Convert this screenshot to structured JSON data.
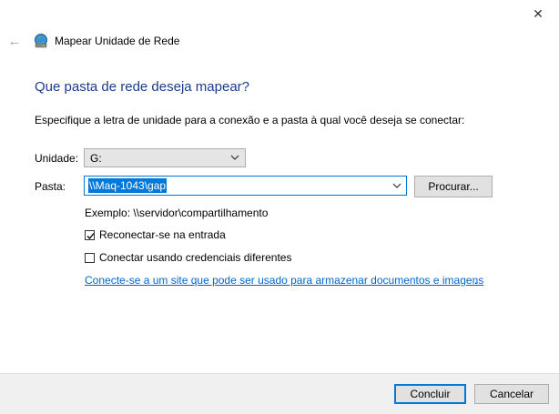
{
  "window": {
    "title": "Mapear Unidade de Rede",
    "close_glyph": "✕",
    "back_glyph": "←",
    "icons": {
      "title": "network-drive-icon",
      "close": "close-icon",
      "back": "back-arrow-icon"
    }
  },
  "main": {
    "heading": "Que pasta de rede deseja mapear?",
    "description": "Especifique a letra de unidade para a conexão e a pasta à qual você deseja se conectar:",
    "drive": {
      "label": "Unidade:",
      "value": "G:"
    },
    "folder": {
      "label": "Pasta:",
      "value": "\\\\Maq-1043\\gap"
    },
    "browse_label": "Procurar...",
    "example": "Exemplo: \\\\servidor\\compartilhamento",
    "reconnect": {
      "label": "Reconectar-se na entrada",
      "checked": true
    },
    "credentials": {
      "label": "Conectar usando credenciais diferentes",
      "checked": false
    },
    "link_text": "Conecte-se a um site que pode ser usado para armazenar documentos e imagens",
    "link_suffix": "."
  },
  "footer": {
    "finish_label": "Concluir",
    "cancel_label": "Cancelar"
  },
  "colors": {
    "heading": "#1a3d8f",
    "accent": "#0078d7",
    "link": "#0066cc",
    "footer_bg": "#f0f0f0"
  }
}
